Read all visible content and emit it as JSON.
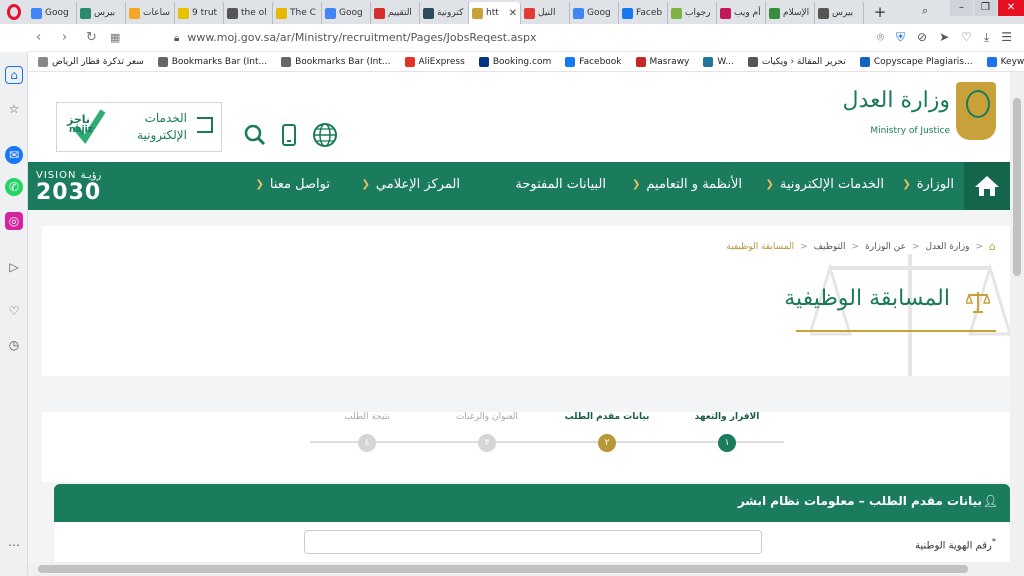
{
  "browser": {
    "tabs": [
      {
        "title": "Goog",
        "icon": "translate-icon",
        "color": "#4285f4"
      },
      {
        "title": "بيرس",
        "icon": "page-icon",
        "color": "#2a8a6a"
      },
      {
        "title": "ساعات",
        "icon": "chart-icon",
        "color": "#f5a623"
      },
      {
        "title": "9 trut",
        "icon": "y-icon",
        "color": "#e6c200"
      },
      {
        "title": "the ol",
        "icon": "g-icon",
        "color": "#555555"
      },
      {
        "title": "The C",
        "icon": "c-icon",
        "color": "#e6b800"
      },
      {
        "title": "Goog",
        "icon": "trends-icon",
        "color": "#4285f4"
      },
      {
        "title": "التقييم",
        "icon": "red-icon",
        "color": "#d32f2f"
      },
      {
        "title": "كترونية",
        "icon": "moj-icon",
        "color": "#2b4b5a"
      },
      {
        "title": "htt",
        "icon": "moj-logo-icon",
        "color": "#c9a13b",
        "active": true
      },
      {
        "title": "النيل",
        "icon": "rss-icon",
        "color": "#e53935"
      },
      {
        "title": "Goog",
        "icon": "g-icon",
        "color": "#4285f4"
      },
      {
        "title": "Faceb",
        "icon": "facebook-icon",
        "color": "#1877f2"
      },
      {
        "title": "رجواب",
        "icon": "green-icon",
        "color": "#7cb342"
      },
      {
        "title": "أم ويب",
        "icon": "web-icon",
        "color": "#c2185b"
      },
      {
        "title": "الإسلام",
        "icon": "islam-icon",
        "color": "#388e3c"
      },
      {
        "title": "بيرس",
        "icon": "doc-icon",
        "color": "#555555"
      }
    ],
    "new_tab": "+",
    "url": "www.moj.gov.sa/ar/Ministry/recruitment/Pages/JobsReqest.aspx",
    "bookmarks": [
      "سعر تذكرة قطار الرياض",
      "Bookmarks Bar (Int...",
      "Bookmarks Bar (Int...",
      "AliExpress",
      "Booking.com",
      "Facebook",
      "Masrawy",
      "W...",
      "تحرير المقالة ‹ ويكيات",
      "Copyscape Plagiaris...",
      "KeywordPro • Free..."
    ],
    "colors": {
      "opera_red": "#e8102d"
    }
  },
  "site": {
    "logo_ar": "وزارة العدل",
    "logo_en": "Ministry of Justice",
    "najiz_line1": "الخدمات",
    "najiz_line2": "الإلكترونية",
    "najiz_brand_ar": "ناجز",
    "najiz_brand_en": "najiz",
    "vision_label": "VISION رؤيـة",
    "vision_year": "2030",
    "nav": [
      "الوزارة",
      "الخدمات الإلكترونية",
      "الأنظمة و التعاميم",
      "البيانات المفتوحة",
      "المركز الإعلامي",
      "تواصل معنا"
    ],
    "breadcrumb": [
      "وزارة العدل",
      "عن الوزارة",
      "التوظيف",
      "المسابقة الوظيفية"
    ],
    "page_title": "المسابقة الوظيفية",
    "steps": [
      {
        "label": "الاقرار والتعهد",
        "num": "١",
        "state": "done"
      },
      {
        "label": "بيانات مقدم الطلب",
        "num": "٢",
        "state": "active"
      },
      {
        "label": "العنوان والرغبات",
        "num": "٣",
        "state": "pending"
      },
      {
        "label": "نتيجة الطلب",
        "num": "٤",
        "state": "pending"
      }
    ],
    "form_title": "بيانات مقدم الطلب – معلومات نظام ابشر",
    "field_national_id": "رقم الهوية الوطنية",
    "field_required_mark": "*",
    "colors": {
      "green": "#1a7c5d",
      "gold": "#c9a13b"
    }
  }
}
